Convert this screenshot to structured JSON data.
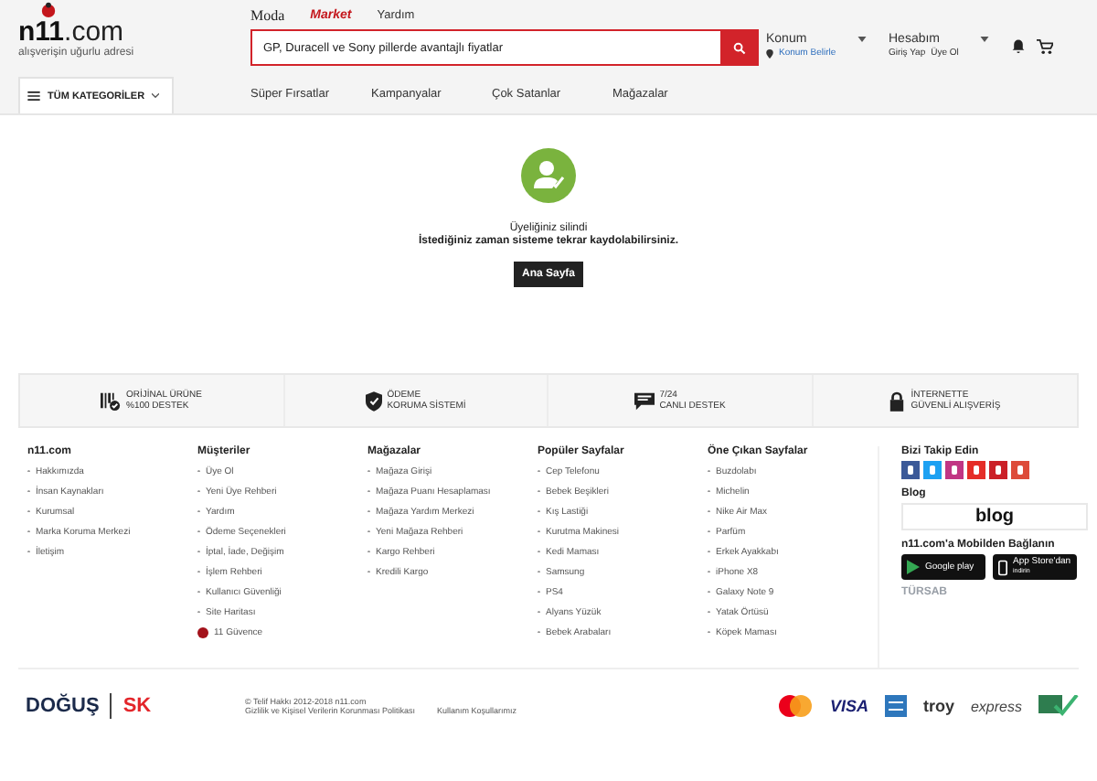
{
  "header": {
    "top_links": [
      {
        "label": "Moda",
        "kind": "moda"
      },
      {
        "label": "Market",
        "kind": "market"
      },
      {
        "label": "Yardım",
        "kind": "plain"
      }
    ],
    "logo": {
      "name": "n11",
      "suffix": ".com",
      "tagline": "alışverişin uğurlu adresi"
    },
    "search": {
      "value": "GP, Duracell ve Sony pillerde avantajlı fiyatlar"
    },
    "location": {
      "label": "Konum",
      "link": "Konum Belirle"
    },
    "account": {
      "label": "Hesabım",
      "links": [
        "Giriş Yap",
        "Üye Ol"
      ]
    },
    "categories_button": "TÜM KATEGORİLER",
    "nav": [
      "Süper Fırsatlar",
      "Kampanyalar",
      "Çok Satanlar",
      "Mağazalar"
    ]
  },
  "message": {
    "title": "Üyeliğiniz silindi",
    "text": "İstediğiniz zaman sisteme tekrar kaydolabilirsiniz.",
    "button": "Ana Sayfa"
  },
  "features": [
    {
      "kind": "barcode",
      "lines": [
        "ORİJİNAL ÜRÜNE",
        "%100 DESTEK"
      ]
    },
    {
      "kind": "shield",
      "lines": [
        "ÖDEME",
        "KORUMA SİSTEMİ"
      ]
    },
    {
      "kind": "chat",
      "lines": [
        "7/24",
        "CANLI DESTEK"
      ]
    },
    {
      "kind": "lock",
      "lines": [
        "İNTERNETTE",
        "GÜVENLİ ALIŞVERİŞ"
      ]
    }
  ],
  "footer_columns": [
    {
      "title": "n11.com",
      "links": [
        {
          "label": "Hakkımızda",
          "kind": "plain"
        },
        {
          "label": "İnsan Kaynakları",
          "kind": "plain"
        },
        {
          "label": "Kurumsal",
          "kind": "plain"
        },
        {
          "label": "Marka Koruma Merkezi",
          "kind": "plain"
        },
        {
          "label": "İletişim",
          "kind": "plain"
        }
      ]
    },
    {
      "title": "Müşteriler",
      "links": [
        {
          "label": "Üye Ol",
          "kind": "plain"
        },
        {
          "label": "Yeni Üye Rehberi",
          "kind": "plain"
        },
        {
          "label": "Yardım",
          "kind": "plain"
        },
        {
          "label": "Ödeme Seçenekleri",
          "kind": "plain"
        },
        {
          "label": "İptal, İade, Değişim",
          "kind": "plain"
        },
        {
          "label": "İşlem Rehberi",
          "kind": "plain"
        },
        {
          "label": "Kullanıcı Güvenliği",
          "kind": "plain"
        },
        {
          "label": "Site Haritası",
          "kind": "plain"
        },
        {
          "label": "11 Güvence",
          "kind": "badge"
        }
      ]
    },
    {
      "title": "Mağazalar",
      "links": [
        {
          "label": "Mağaza Girişi",
          "kind": "plain"
        },
        {
          "label": "Mağaza Puanı Hesaplaması",
          "kind": "plain"
        },
        {
          "label": "Mağaza Yardım Merkezi",
          "kind": "plain"
        },
        {
          "label": "Yeni Mağaza Rehberi",
          "kind": "plain"
        },
        {
          "label": "Kargo Rehberi",
          "kind": "plain"
        },
        {
          "label": "Kredili Kargo",
          "kind": "plain"
        }
      ]
    },
    {
      "title": "Popüler Sayfalar",
      "links": [
        {
          "label": "Cep Telefonu",
          "kind": "plain"
        },
        {
          "label": "Bebek Beşikleri",
          "kind": "plain"
        },
        {
          "label": "Kış Lastiği",
          "kind": "plain"
        },
        {
          "label": "Kurutma Makinesi",
          "kind": "plain"
        },
        {
          "label": "Kedi Maması",
          "kind": "plain"
        },
        {
          "label": "Samsung",
          "kind": "plain"
        },
        {
          "label": "PS4",
          "kind": "plain"
        },
        {
          "label": "Alyans Yüzük",
          "kind": "plain"
        },
        {
          "label": "Bebek Arabaları",
          "kind": "plain"
        }
      ]
    },
    {
      "title": "Öne Çıkan Sayfalar",
      "links": [
        {
          "label": "Buzdolabı",
          "kind": "plain"
        },
        {
          "label": "Michelin",
          "kind": "plain"
        },
        {
          "label": "Nike Air Max",
          "kind": "plain"
        },
        {
          "label": "Parfüm",
          "kind": "plain"
        },
        {
          "label": "Erkek Ayakkabı",
          "kind": "plain"
        },
        {
          "label": "iPhone X8",
          "kind": "plain"
        },
        {
          "label": "Galaxy Note 9",
          "kind": "plain"
        },
        {
          "label": "Yatak Örtüsü",
          "kind": "plain"
        },
        {
          "label": "Köpek Maması",
          "kind": "plain"
        }
      ]
    }
  ],
  "social": {
    "title": "Bizi Takip Edin"
  },
  "blog": {
    "title": "Blog",
    "logo": "blog"
  },
  "mobile": {
    "title": "n11.com'a Mobilden Bağlanın",
    "stores": [
      {
        "kind": "google",
        "label": "Google play"
      },
      {
        "kind": "apple",
        "label": "App Store'dan",
        "sub": "indirin"
      }
    ]
  },
  "tursab": "TÜRSAB",
  "bottom": {
    "brands": [
      "DOĞUŞ",
      "SK"
    ],
    "copyright": "© Telif Hakkı 2012-2018 n11.com",
    "links": [
      "Gizlilik ve Kişisel Verilerin Korunması Politikası",
      "Kullanım Koşullarımız"
    ],
    "payments": [
      {
        "kind": "mastercard"
      },
      {
        "kind": "visa",
        "label": "VISA"
      },
      {
        "kind": "amex"
      },
      {
        "kind": "troy",
        "label": "troy"
      },
      {
        "kind": "express",
        "label": "express"
      },
      {
        "kind": "pei"
      }
    ]
  }
}
